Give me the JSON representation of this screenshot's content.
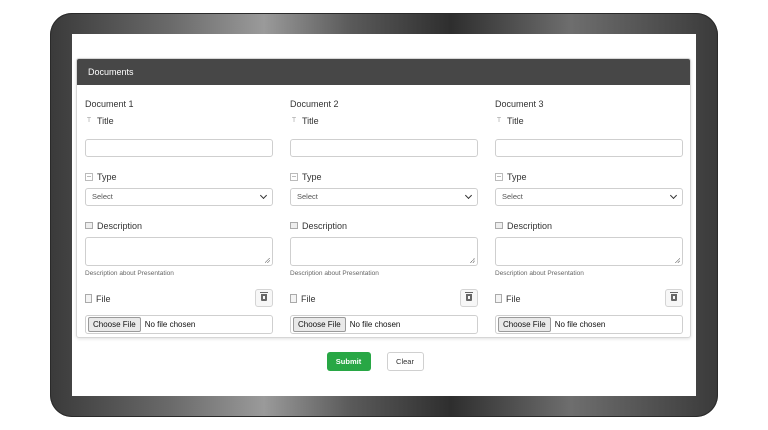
{
  "panel": {
    "header_title": "Documents"
  },
  "documents": [
    {
      "title": "Document 1",
      "title_label": "Title",
      "title_value": "",
      "type_label": "Type",
      "type_selected": "Select",
      "description_label": "Description",
      "description_value": "",
      "description_help": "Description about Presentation",
      "file_label": "File",
      "choose_file_label": "Choose File",
      "no_file_text": "No file chosen"
    },
    {
      "title": "Document 2",
      "title_label": "Title",
      "title_value": "",
      "type_label": "Type",
      "type_selected": "Select",
      "description_label": "Description",
      "description_value": "",
      "description_help": "Description about Presentation",
      "file_label": "File",
      "choose_file_label": "Choose File",
      "no_file_text": "No file chosen"
    },
    {
      "title": "Document 3",
      "title_label": "Title",
      "title_value": "",
      "type_label": "Type",
      "type_selected": "Select",
      "description_label": "Description",
      "description_value": "",
      "description_help": "Description about Presentation",
      "file_label": "File",
      "choose_file_label": "Choose File",
      "no_file_text": "No file chosen"
    }
  ],
  "actions": {
    "submit_label": "Submit",
    "clear_label": "Clear"
  },
  "colors": {
    "header_bg": "#474747",
    "submit_bg": "#28a745"
  },
  "icons": {
    "title": "text-icon",
    "type": "list-icon",
    "description": "textbox-icon",
    "file": "file-icon",
    "delete": "trash-icon"
  }
}
